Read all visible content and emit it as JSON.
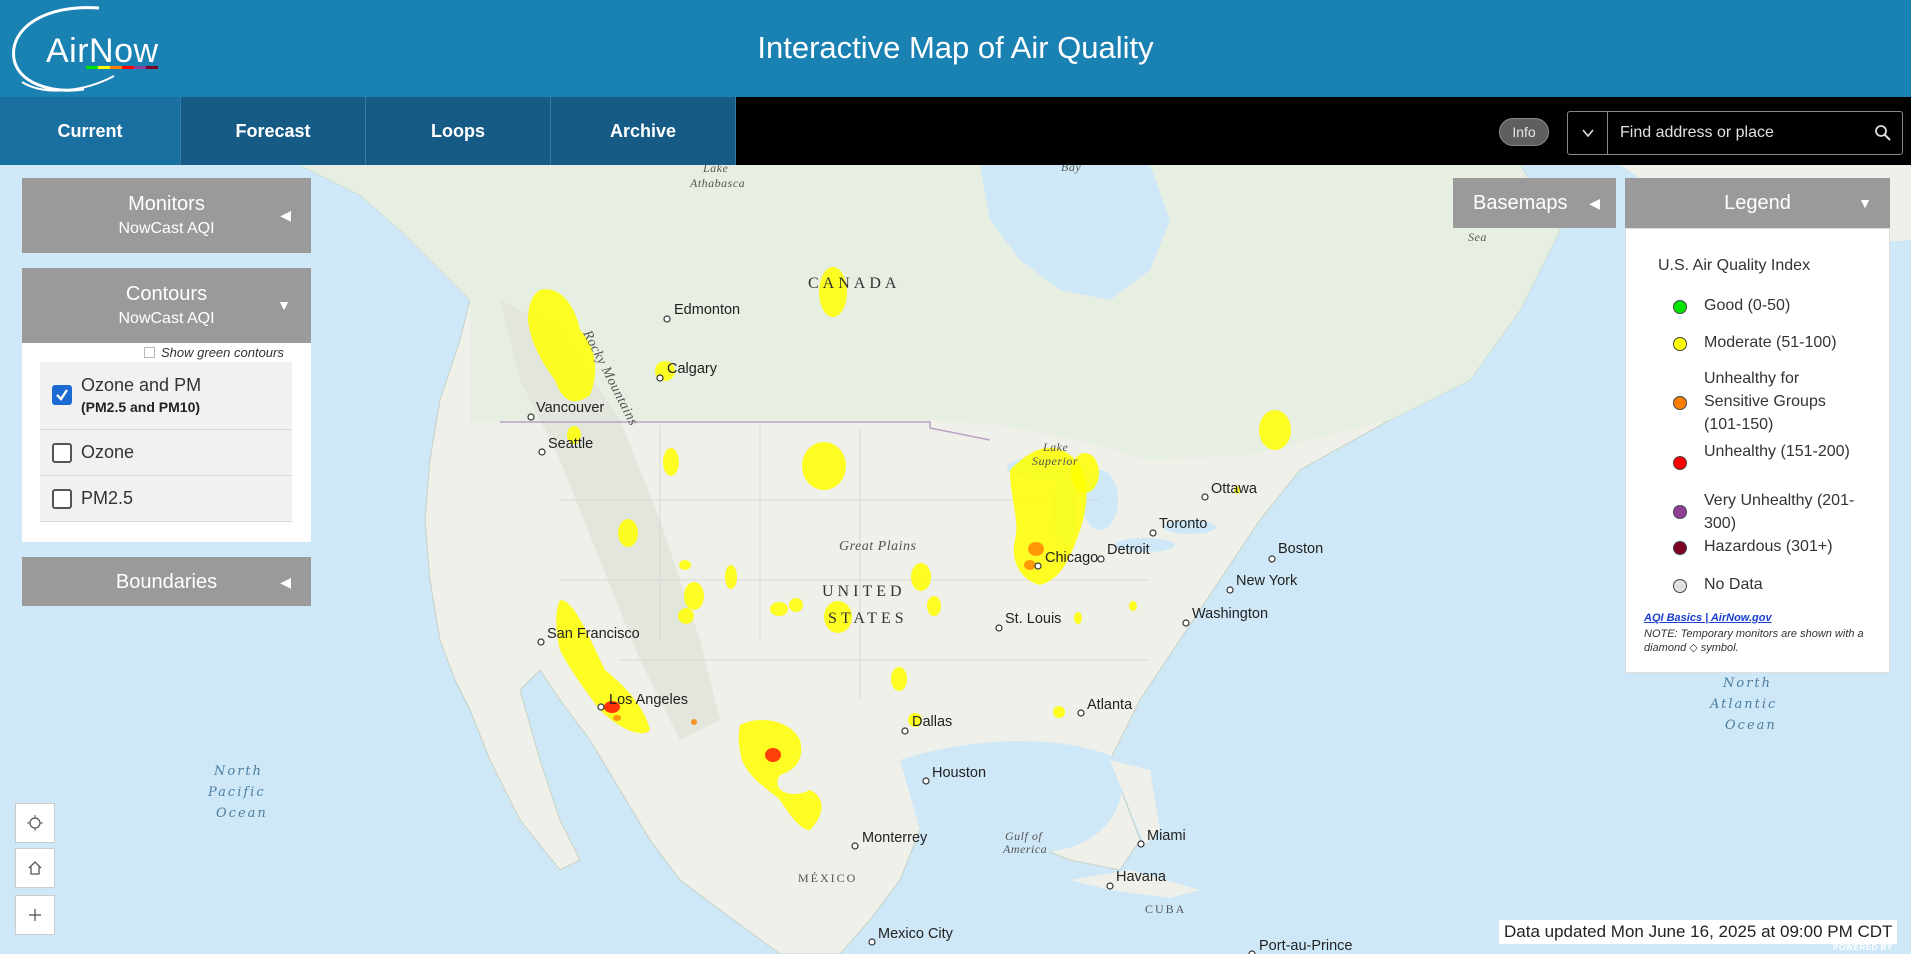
{
  "header": {
    "logo_text": "AirNow",
    "title": "Interactive Map of Air Quality"
  },
  "nav": {
    "tabs": [
      {
        "label": "Current",
        "active": true
      },
      {
        "label": "Forecast",
        "active": false
      },
      {
        "label": "Loops",
        "active": false
      },
      {
        "label": "Archive",
        "active": false
      }
    ],
    "info_label": "Info",
    "search_placeholder": "Find address or place"
  },
  "left_panels": {
    "monitors": {
      "title": "Monitors",
      "subtitle": "NowCast AQI"
    },
    "contours": {
      "title": "Contours",
      "subtitle": "NowCast AQI"
    },
    "show_green_contours": "Show green contours",
    "layers": [
      {
        "label": "Ozone and PM",
        "sublabel": "(PM2.5 and PM10)",
        "checked": true
      },
      {
        "label": "Ozone",
        "sublabel": "",
        "checked": false
      },
      {
        "label": "PM2.5",
        "sublabel": "",
        "checked": false
      }
    ],
    "boundaries": {
      "title": "Boundaries"
    }
  },
  "basemaps": {
    "title": "Basemaps"
  },
  "legend": {
    "header": "Legend",
    "title": "U.S. Air Quality Index",
    "items": [
      {
        "label": "Good (0-50)",
        "color": "#00e400"
      },
      {
        "label": "Moderate (51-100)",
        "color": "#ffff00"
      },
      {
        "label": "Unhealthy for Sensitive Groups (101-150)",
        "color": "#ff7e00"
      },
      {
        "label": "Unhealthy (151-200)",
        "color": "#ff0000"
      },
      {
        "label": "Very Unhealthy (201-300)",
        "color": "#8f3f97"
      },
      {
        "label": "Hazardous (301+)",
        "color": "#7e0023"
      },
      {
        "label": "No Data",
        "color": "#e0e0e0"
      }
    ],
    "link": "AQI Basics | AirNow.gov",
    "note": "NOTE: Temporary monitors are shown with a diamond ◇ symbol."
  },
  "map": {
    "cities": [
      "Edmonton",
      "Calgary",
      "Vancouver",
      "Seattle",
      "San Francisco",
      "Los Angeles",
      "Dallas",
      "Houston",
      "Monterrey",
      "Mexico City",
      "St. Louis",
      "Chicago",
      "Detroit",
      "Toronto",
      "Ottawa",
      "Boston",
      "New York",
      "Washington",
      "Atlanta",
      "Miami",
      "Havana",
      "Port-au-Prince"
    ],
    "regions": {
      "canada": "CANADA",
      "united": "UNITED",
      "states": "STATES",
      "great_plains": "Great Plains",
      "mexico": "MÉXICO",
      "cuba": "CUBA",
      "rocky": "Rocky Mountains",
      "lake_athabasca_1": "Lake",
      "lake_athabasca_2": "Athabasca",
      "lake_superior_1": "Lake",
      "lake_superior_2": "Superior",
      "gulf_1": "Gulf of",
      "gulf_2": "America",
      "bay": "Bay",
      "sea": "Sea"
    },
    "oceans": {
      "north_pacific": [
        "North",
        "Pacific",
        "Ocean"
      ],
      "north_atlantic": [
        "North",
        "Atlantic",
        "Ocean"
      ]
    }
  },
  "footer": {
    "data_updated": "Data updated Mon June 16, 2025 at 09:00 PM CDT",
    "powered_by": "POWERED BY"
  },
  "colors": {
    "header_bg": "#1a81b3",
    "nav_tab": "#165a86",
    "panel_gray": "#9a9a9a",
    "moderate": "#ffff00",
    "usg": "#ff7e00",
    "unhealthy": "#ff0000"
  }
}
